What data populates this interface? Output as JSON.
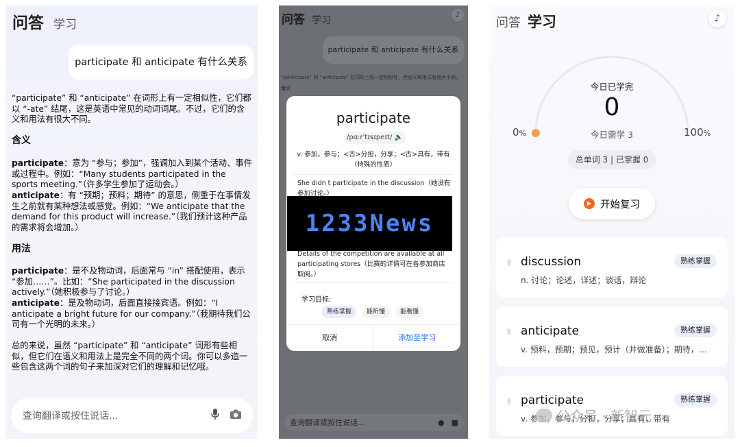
{
  "panel1": {
    "tab_active": "问答",
    "tab": "学习",
    "question": "participate 和 anticipate 有什么关系",
    "intro": "“participate” 和 “anticipate” 在词形上有一定相似性，它们都以 “-ate” 结尾，这是英语中常见的动词词尾。不过，它们的含义和用法有很大不同。",
    "meaning_heading": "含义",
    "meaning_p1_word": "participate",
    "meaning_p1_text": "：意为 “参与；参加”，强调加入到某个活动、事件或过程中。例如：“Many students participated in the sports meeting.”（许多学生参加了运动会。）",
    "meaning_p2_word": "anticipate",
    "meaning_p2_text": "：有 “预期；预料；期待” 的意思，侧重于在事情发生之前就有某种想法或感觉。例如：“We anticipate that the demand for this product will increase.”（我们预计这种产品的需求将会增加。）",
    "usage_heading": "用法",
    "usage_p1_word": "participate",
    "usage_p1_text": "：是不及物动词，后面常与 “in” 搭配使用，表示 “参加……”。比如：“She participated in the discussion actively.”（她积极参与了讨论。）",
    "usage_p2_word": "anticipate",
    "usage_p2_text": "：是及物动词，后面直接接宾语。例如：“I anticipate a bright future for our company.”（我期待我们公司有一个光明的未来。）",
    "summary": "总的来说，虽然 “participate” 和 “anticipate” 词形有些相似，但它们在语义和用法上是完全不同的两个词。你可以多造一些包含这两个词的句子来加深对它们的理解和记忆哦。",
    "input_placeholder": "查询翻译或按住说话..."
  },
  "panel2": {
    "tab_active": "问答",
    "tab": "学习",
    "question": "participate 和 anticipate 有什么关系",
    "ghost_line": "“participate” 和 “anticipate” 在词形上有一定相似性，但含义和用法有很大不同。",
    "ghost_heading": "含义",
    "popup_word": "participate",
    "popup_phonetic": "/pɑːrˈtɪsɪpeɪt/",
    "popup_definition": "v. 参加，参与；<古>分担，分享；<古>具有，带有（特殊的性质）",
    "popup_example1": "She didn t participate in the discussion（她没有参加讨论。）",
    "popup_example2": "Details of the competition are available at all participating stores（比赛的详情可在各参加商店取阅。）",
    "goal_label": "学习目标:",
    "chips": [
      "熟练掌握",
      "能听懂",
      "能看懂"
    ],
    "cancel_label": "取消",
    "add_label": "添加至学习",
    "watermark_banner": "1233News",
    "input_placeholder": "查询翻译或按住说话..."
  },
  "panel3": {
    "tab_active": "学习",
    "tab": "问答",
    "today_learned_label": "今日已学完",
    "today_learned_value": "0",
    "today_need_label": "今日需学 3",
    "gauge_min": "0",
    "gauge_max": "100",
    "percent_sign": "%",
    "stat_text": "总单词 3 | 已掌握 0",
    "progress": 0,
    "start_button": "开始复习",
    "words": [
      {
        "word": "discussion",
        "meaning": "n. 讨论；论述，详述；谈话，辩论",
        "badge": "熟练掌握"
      },
      {
        "word": "anticipate",
        "meaning": "v. 预料，预期；预见，预计（并做准备）；期待，盼望",
        "badge": "熟练掌握"
      },
      {
        "word": "participate",
        "meaning": "v. 参加，参与；分担，分享；具有，带有",
        "badge": "熟练掌握"
      }
    ],
    "watermark": "公众号 · 新智元"
  },
  "colors": {
    "accent_blue": "#2a6ff0",
    "gauge_orange": "#f5a04a",
    "play_orange": "#f26522",
    "news_blue": "#4b85f0"
  }
}
